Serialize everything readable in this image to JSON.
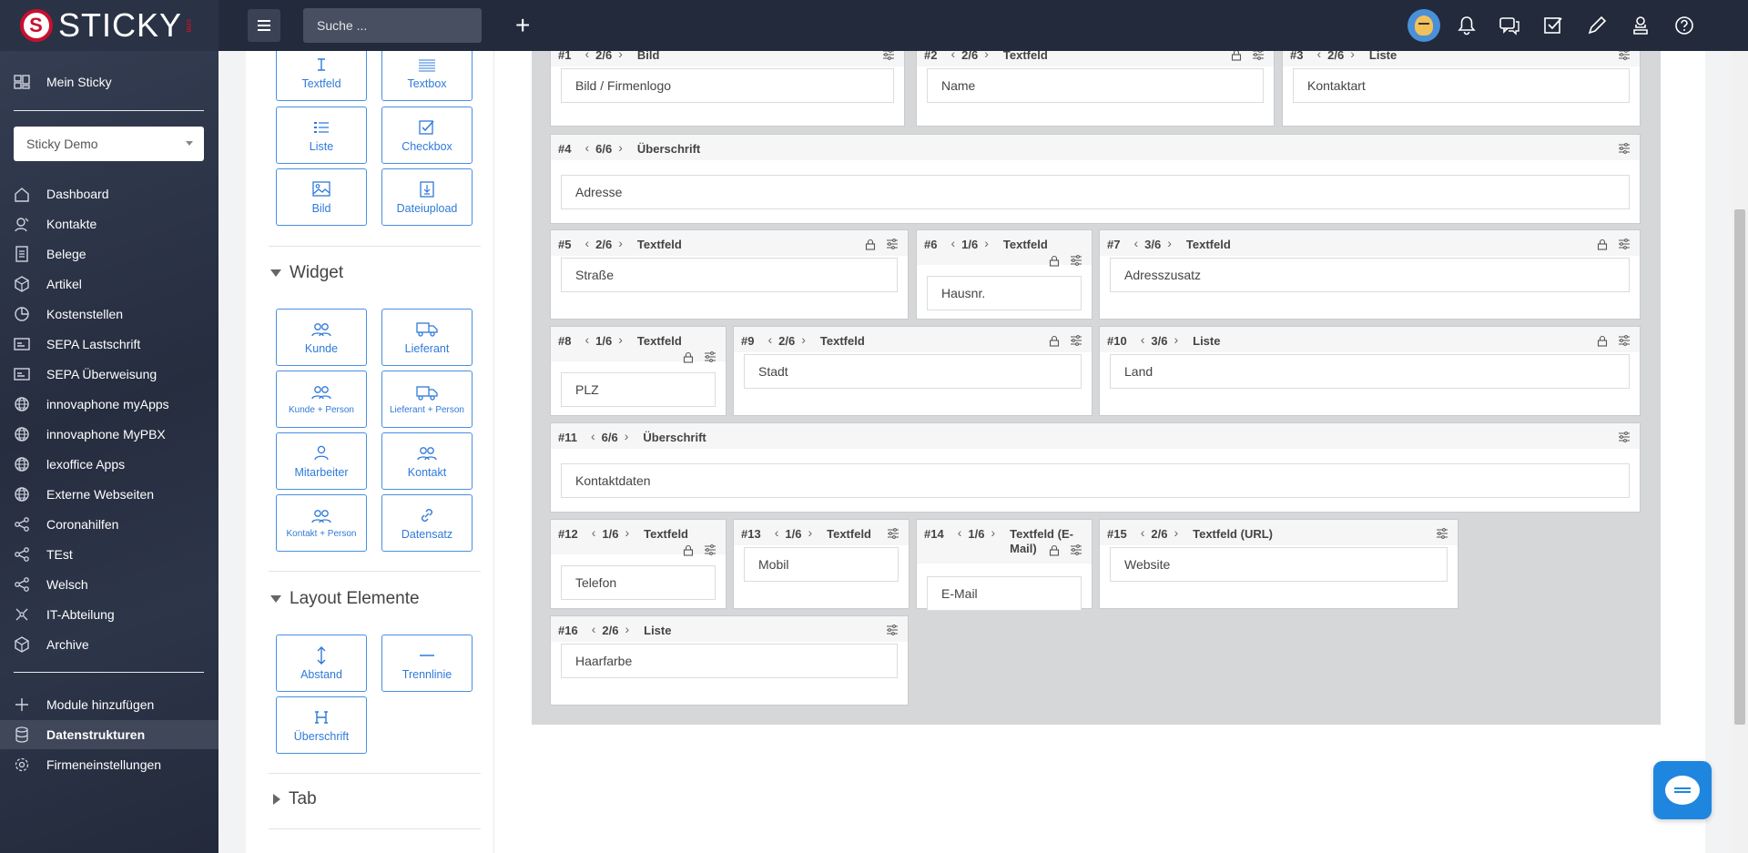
{
  "brand": {
    "name": "STICKY",
    "logo_mark": "S",
    "logo_tag": "crm"
  },
  "topbar": {
    "search_placeholder": "Suche ...",
    "icons": [
      "bell-icon",
      "chat-icon",
      "tasks-icon",
      "edit-icon",
      "user-icon",
      "help-icon"
    ]
  },
  "sidebar": {
    "mein_sticky": "Mein Sticky",
    "company": "Sticky Demo",
    "items": [
      {
        "label": "Dashboard",
        "icon": "home-icon"
      },
      {
        "label": "Kontakte",
        "icon": "contacts-icon"
      },
      {
        "label": "Belege",
        "icon": "document-icon"
      },
      {
        "label": "Artikel",
        "icon": "box-icon"
      },
      {
        "label": "Kostenstellen",
        "icon": "pie-icon"
      },
      {
        "label": "SEPA Lastschrift",
        "icon": "card-icon"
      },
      {
        "label": "SEPA Überweisung",
        "icon": "card-icon"
      },
      {
        "label": "innovaphone myApps",
        "icon": "globe-icon"
      },
      {
        "label": "innovaphone MyPBX",
        "icon": "globe-icon"
      },
      {
        "label": "lexoffice Apps",
        "icon": "globe-icon"
      },
      {
        "label": "Externe Webseiten",
        "icon": "globe-icon"
      },
      {
        "label": "Coronahilfen",
        "icon": "share-icon"
      },
      {
        "label": "TEst",
        "icon": "share-icon"
      },
      {
        "label": "Welsch",
        "icon": "share-icon"
      },
      {
        "label": "IT-Abteilung",
        "icon": "network-icon"
      },
      {
        "label": "Archive",
        "icon": "box-icon"
      }
    ],
    "bottom": [
      {
        "label": "Module hinzufügen",
        "icon": "plus-icon"
      },
      {
        "label": "Datenstrukturen",
        "icon": "database-icon"
      },
      {
        "label": "Firmeneinstellungen",
        "icon": "gear-icon"
      }
    ]
  },
  "palette": {
    "basic": [
      {
        "label": "Textfeld",
        "icon": "text-cursor-icon"
      },
      {
        "label": "Textbox",
        "icon": "textbox-icon"
      },
      {
        "label": "Liste",
        "icon": "list-icon"
      },
      {
        "label": "Checkbox",
        "icon": "checkbox-icon"
      },
      {
        "label": "Bild",
        "icon": "image-icon"
      },
      {
        "label": "Dateiupload",
        "icon": "file-upload-icon"
      }
    ],
    "widget_title": "Widget",
    "widgets": [
      {
        "label": "Kunde",
        "icon": "users-icon"
      },
      {
        "label": "Lieferant",
        "icon": "truck-icon"
      },
      {
        "label": "Kunde + Person",
        "icon": "users-icon"
      },
      {
        "label": "Lieferant + Person",
        "icon": "truck-icon"
      },
      {
        "label": "Mitarbeiter",
        "icon": "user-icon"
      },
      {
        "label": "Kontakt",
        "icon": "users-icon"
      },
      {
        "label": "Kontakt + Person",
        "icon": "users-icon"
      },
      {
        "label": "Datensatz",
        "icon": "link-icon"
      }
    ],
    "layout_title": "Layout Elemente",
    "layout": [
      {
        "label": "Abstand",
        "icon": "spacing-icon"
      },
      {
        "label": "Trennlinie",
        "icon": "divider-icon"
      },
      {
        "label": "Überschrift",
        "icon": "heading-icon"
      }
    ],
    "tab_title": "Tab"
  },
  "fields": [
    {
      "num": "#1",
      "size": "2/6",
      "type": "Bild",
      "label": "Bild / Firmenlogo"
    },
    {
      "num": "#2",
      "size": "2/6",
      "type": "Textfeld",
      "label": "Name"
    },
    {
      "num": "#3",
      "size": "2/6",
      "type": "Liste",
      "label": "Kontaktart"
    },
    {
      "num": "#4",
      "size": "6/6",
      "type": "Überschrift",
      "label": "Adresse"
    },
    {
      "num": "#5",
      "size": "2/6",
      "type": "Textfeld",
      "label": "Straße"
    },
    {
      "num": "#6",
      "size": "1/6",
      "type": "Textfeld",
      "label": "Hausnr."
    },
    {
      "num": "#7",
      "size": "3/6",
      "type": "Textfeld",
      "label": "Adresszusatz"
    },
    {
      "num": "#8",
      "size": "1/6",
      "type": "Textfeld",
      "label": "PLZ"
    },
    {
      "num": "#9",
      "size": "2/6",
      "type": "Textfeld",
      "label": "Stadt"
    },
    {
      "num": "#10",
      "size": "3/6",
      "type": "Liste",
      "label": "Land"
    },
    {
      "num": "#11",
      "size": "6/6",
      "type": "Überschrift",
      "label": "Kontaktdaten"
    },
    {
      "num": "#12",
      "size": "1/6",
      "type": "Textfeld",
      "label": "Telefon"
    },
    {
      "num": "#13",
      "size": "1/6",
      "type": "Textfeld",
      "label": "Mobil"
    },
    {
      "num": "#14",
      "size": "1/6",
      "type": "Textfeld (E-Mail)",
      "label": "E-Mail"
    },
    {
      "num": "#15",
      "size": "2/6",
      "type": "Textfeld (URL)",
      "label": "Website"
    },
    {
      "num": "#16",
      "size": "2/6",
      "type": "Liste",
      "label": "Haarfarbe"
    }
  ]
}
